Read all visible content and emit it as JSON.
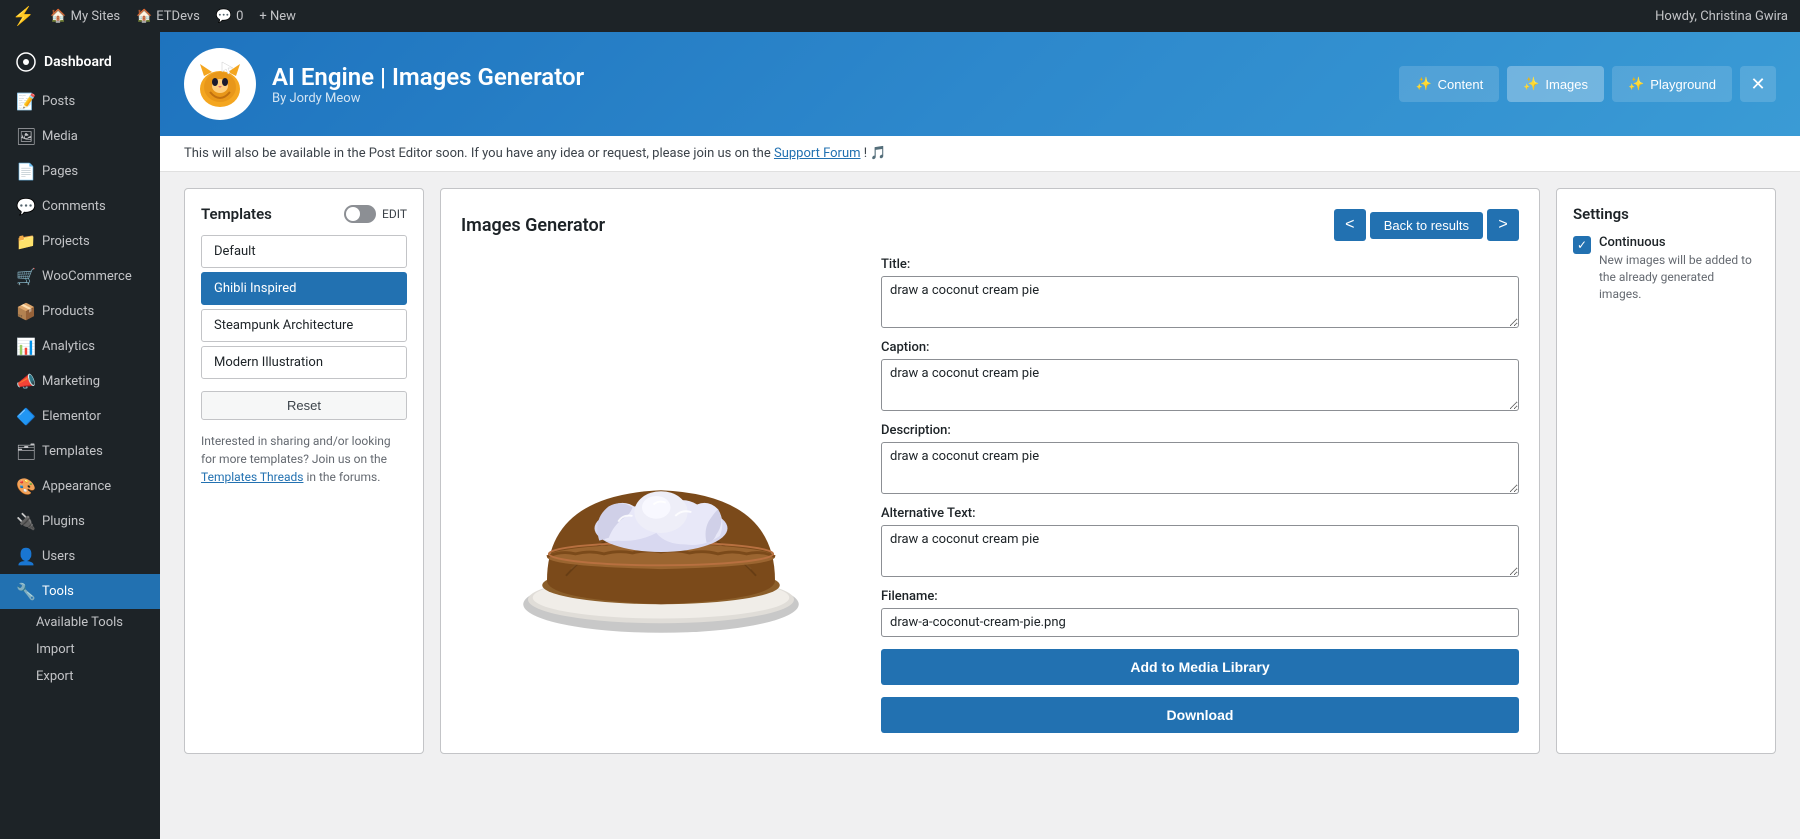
{
  "adminbar": {
    "wp_logo": "⚡",
    "sites_label": "My Sites",
    "site_name": "ETDevs",
    "comments_label": "0",
    "new_label": "+ New",
    "user_greeting": "Howdy, Christina Gwira"
  },
  "sidebar": {
    "brand": "Dashboard",
    "items": [
      {
        "id": "posts",
        "label": "Posts",
        "icon": "📝"
      },
      {
        "id": "media",
        "label": "Media",
        "icon": "🖼"
      },
      {
        "id": "pages",
        "label": "Pages",
        "icon": "📄"
      },
      {
        "id": "comments",
        "label": "Comments",
        "icon": "💬"
      },
      {
        "id": "projects",
        "label": "Projects",
        "icon": "📁"
      },
      {
        "id": "woocommerce",
        "label": "WooCommerce",
        "icon": "🛒"
      },
      {
        "id": "products",
        "label": "Products",
        "icon": "📦"
      },
      {
        "id": "analytics",
        "label": "Analytics",
        "icon": "📊"
      },
      {
        "id": "marketing",
        "label": "Marketing",
        "icon": "📣"
      },
      {
        "id": "elementor",
        "label": "Elementor",
        "icon": "🔷"
      },
      {
        "id": "templates",
        "label": "Templates",
        "icon": "🗂"
      },
      {
        "id": "appearance",
        "label": "Appearance",
        "icon": "🎨"
      },
      {
        "id": "plugins",
        "label": "Plugins",
        "icon": "🔌"
      },
      {
        "id": "users",
        "label": "Users",
        "icon": "👤"
      },
      {
        "id": "tools",
        "label": "Tools",
        "icon": "🔧"
      }
    ],
    "submenu_items": [
      {
        "label": "Available Tools"
      },
      {
        "label": "Import"
      },
      {
        "label": "Export"
      }
    ]
  },
  "plugin_header": {
    "title": "AI Engine | Images Generator",
    "subtitle": "By Jordy Meow",
    "nav_buttons": [
      {
        "id": "content",
        "label": "Content",
        "icon": "✨"
      },
      {
        "id": "images",
        "label": "Images",
        "icon": "✨"
      },
      {
        "id": "playground",
        "label": "Playground",
        "icon": "✨"
      }
    ],
    "close_icon": "✕"
  },
  "notice": {
    "text": "This will also be available in the Post Editor soon. If you have any idea or request, please join us on the",
    "link_text": "Support Forum",
    "suffix": "! 🎵"
  },
  "templates": {
    "title": "Templates",
    "edit_label": "EDIT",
    "items": [
      {
        "id": "default",
        "label": "Default",
        "active": false
      },
      {
        "id": "ghibli",
        "label": "Ghibli Inspired",
        "active": true
      },
      {
        "id": "steampunk",
        "label": "Steampunk Architecture",
        "active": false
      },
      {
        "id": "modern",
        "label": "Modern Illustration",
        "active": false
      }
    ],
    "reset_label": "Reset",
    "footer_text": "Interested in sharing and/or looking for more templates? Join us on the",
    "footer_link": "Templates Threads",
    "footer_suffix": "in the forums."
  },
  "generator": {
    "title": "Images Generator",
    "nav": {
      "prev_label": "<",
      "back_label": "Back to results",
      "next_label": ">"
    },
    "fields": {
      "title_label": "Title:",
      "title_value": "draw a coconut cream pie",
      "caption_label": "Caption:",
      "caption_value": "draw a coconut cream pie",
      "description_label": "Description:",
      "description_value": "draw a coconut cream pie",
      "alt_label": "Alternative Text:",
      "alt_value": "draw a coconut cream pie",
      "filename_label": "Filename:",
      "filename_value": "draw-a-coconut-cream-pie.png"
    },
    "buttons": {
      "add_to_library": "Add to Media Library",
      "download": "Download"
    }
  },
  "settings": {
    "title": "Settings",
    "option": {
      "label": "Continuous",
      "description": "New images will be added to the already generated images."
    }
  },
  "colors": {
    "brand_blue": "#2271b1",
    "dark_bg": "#1d2327",
    "active_blue": "#2271b1"
  }
}
